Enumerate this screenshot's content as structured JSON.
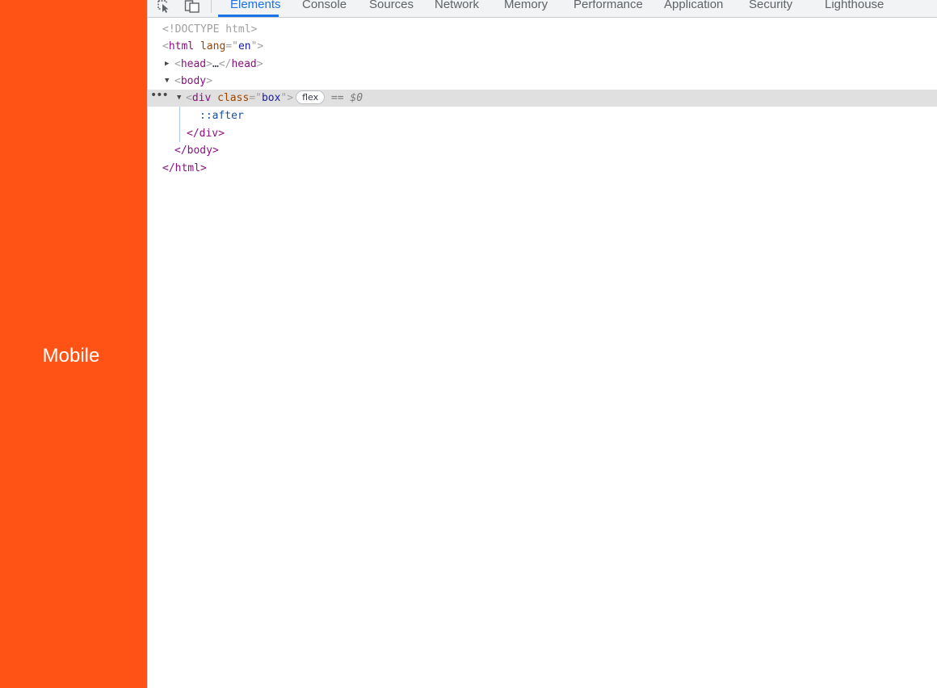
{
  "viewport": {
    "label": "Mobile",
    "background": "#ff5316"
  },
  "toolbar": {
    "icons": [
      "inspect-element-icon",
      "device-toolbar-icon"
    ],
    "tabs": [
      {
        "label": "Elements",
        "active": true
      },
      {
        "label": "Console",
        "active": false
      },
      {
        "label": "Sources",
        "active": false
      },
      {
        "label": "Network",
        "active": false
      },
      {
        "label": "Memory",
        "active": false
      },
      {
        "label": "Performance",
        "active": false
      },
      {
        "label": "Application",
        "active": false
      },
      {
        "label": "Security",
        "active": false
      },
      {
        "label": "Lighthouse",
        "active": false
      }
    ],
    "accent": "#1a73e8"
  },
  "dom": {
    "doctype": "<!DOCTYPE html>",
    "html_open_tag": "html",
    "html_attr": "lang",
    "html_attr_val": "en",
    "head_tag": "head",
    "ellipsis": "…",
    "body_tag": "body",
    "div_tag": "div",
    "div_attr": "class",
    "div_attr_val": "box",
    "flex_badge": "flex",
    "selected_marker": "== $0",
    "pseudo": "::after",
    "div_close": "</div>",
    "body_close": "</body>",
    "html_close": "</html>",
    "selected_row_color": "#e0e0e0"
  }
}
